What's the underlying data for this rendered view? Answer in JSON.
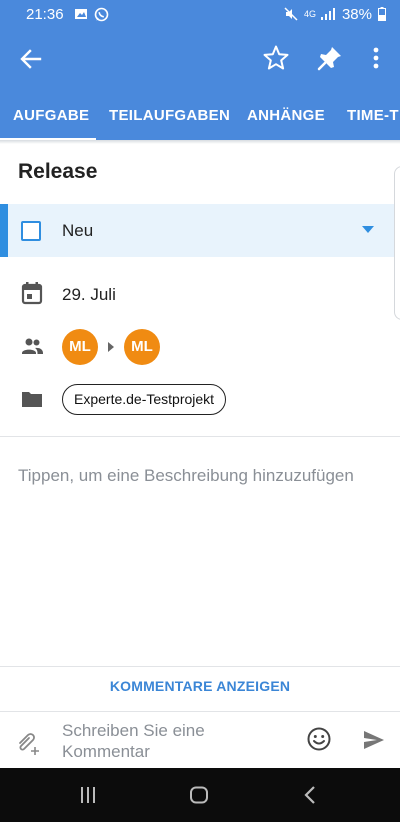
{
  "status_bar": {
    "time": "21:36",
    "network": "4G",
    "battery": "38%"
  },
  "app_bar": {
    "back_icon": "arrow-back-icon",
    "star_icon": "star-outline-icon",
    "pin_icon": "pin-icon",
    "more_icon": "more-vert-icon"
  },
  "tabs": [
    {
      "label": "AUFGABE",
      "active": true
    },
    {
      "label": "TEILAUFGABEN",
      "active": false
    },
    {
      "label": "ANHÄNGE",
      "active": false
    },
    {
      "label": "TIME-T",
      "active": false
    }
  ],
  "task": {
    "title": "Release",
    "status": "Neu",
    "date": "29. Juli",
    "assigner_initials": "ML",
    "assignee_initials": "ML",
    "project": "Experte.de-Testprojekt",
    "description_placeholder": "Tippen, um eine Beschreibung hinzuzufügen"
  },
  "comments": {
    "show_label": "KOMMENTARE ANZEIGEN",
    "input_placeholder": "Schreiben Sie eine Kommentar"
  },
  "colors": {
    "primary": "#4a89dc",
    "accent_blue": "#2f8ee0",
    "avatar_orange": "#f08b12",
    "status_row_bg": "#e8f3fc"
  }
}
